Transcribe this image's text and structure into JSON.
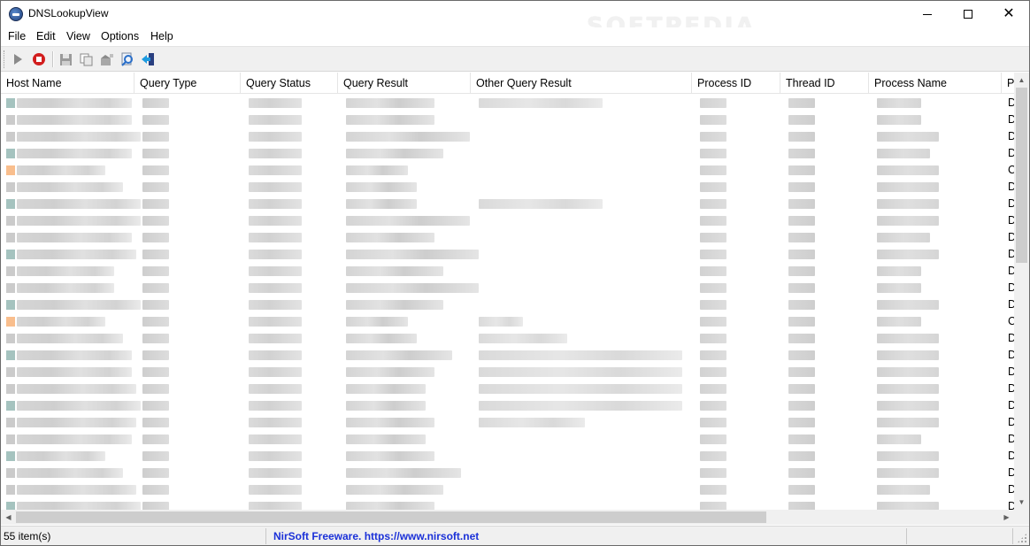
{
  "window": {
    "title": "DNSLookupView",
    "watermark": "SOFTPEDIA",
    "min_glyph": "",
    "close_glyph": "✕"
  },
  "menu": {
    "items": [
      "File",
      "Edit",
      "View",
      "Options",
      "Help"
    ]
  },
  "toolbar": {
    "buttons": [
      {
        "name": "start-icon",
        "color": "#8a8a8a"
      },
      {
        "name": "stop-icon",
        "color": "#d21e1e"
      },
      {
        "name": "save-icon",
        "color": "#7a7a7a"
      },
      {
        "name": "copy-icon",
        "color": "#7a7a7a"
      },
      {
        "name": "properties-icon",
        "color": "#7a7a7a"
      },
      {
        "name": "find-icon",
        "color": "#2a6fc9"
      },
      {
        "name": "exit-icon",
        "color": "#1e7fd0"
      }
    ]
  },
  "list": {
    "columns": [
      "Host Name",
      "Query Type",
      "Query Status",
      "Query Result",
      "Other Query Result",
      "Process ID",
      "Thread ID",
      "Process Name",
      "P"
    ],
    "process_path_initials": [
      "D",
      "D",
      "D",
      "D",
      "C",
      "D",
      "D",
      "D",
      "D",
      "D",
      "D",
      "D",
      "D",
      "C",
      "D",
      "D",
      "D",
      "D",
      "D",
      "D",
      "D",
      "D",
      "D",
      "D",
      "D"
    ]
  },
  "status": {
    "count": "55 item(s)",
    "link": "NirSoft Freeware. https://www.nirsoft.net"
  },
  "colors": {
    "accent_link": "#1b31d8",
    "stop_red": "#d21e1e",
    "row_icon_orange": "#f7a25c",
    "row_icon_teal": "#7fa9a4"
  }
}
